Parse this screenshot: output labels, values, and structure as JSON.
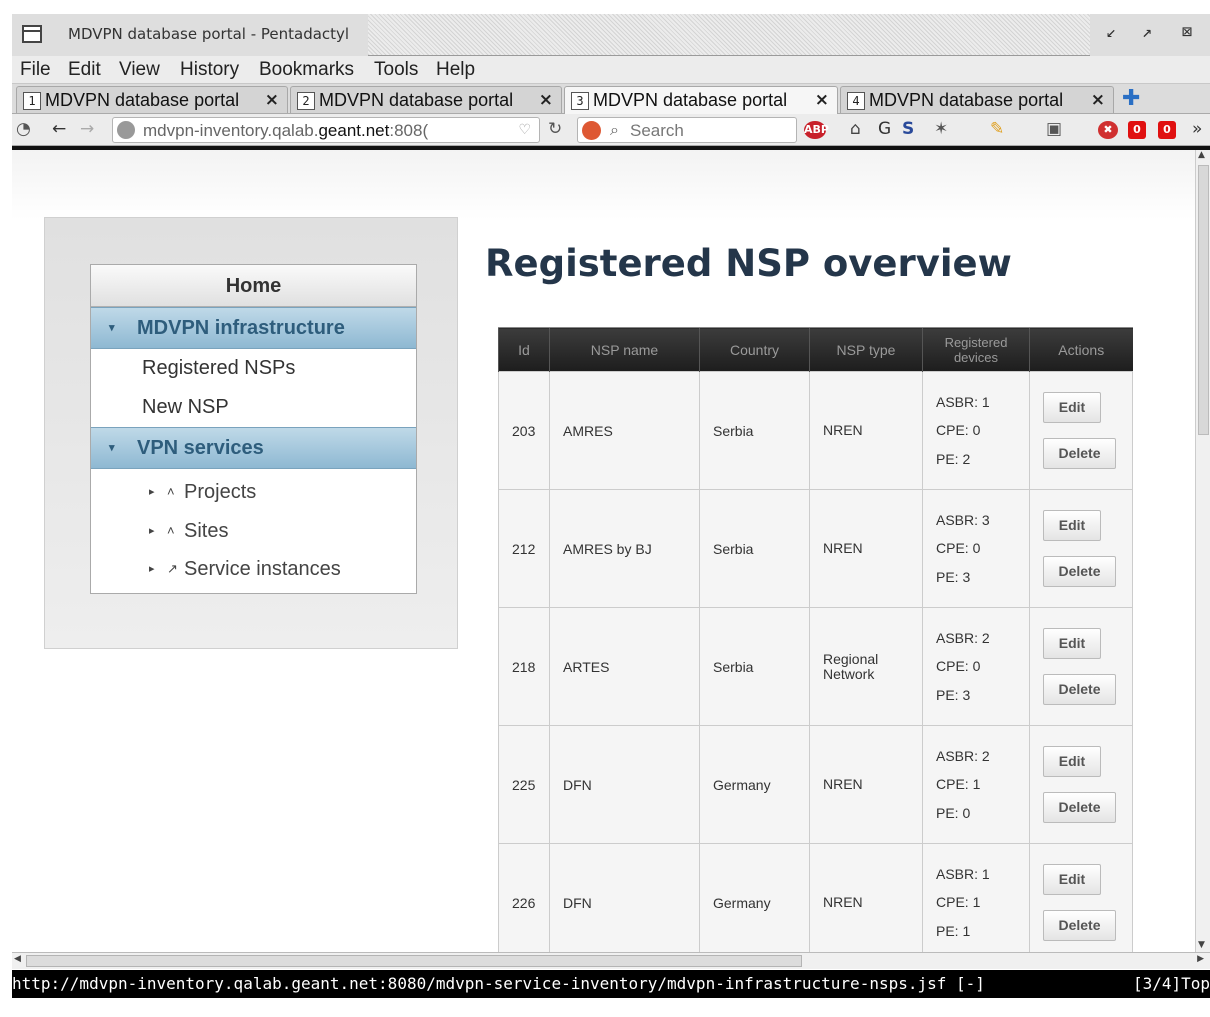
{
  "window": {
    "title": "MDVPN database portal - Pentadactyl"
  },
  "menubar": [
    "File",
    "Edit",
    "View",
    "History",
    "Bookmarks",
    "Tools",
    "Help"
  ],
  "tabs": [
    {
      "num": "1",
      "label": "MDVPN database portal"
    },
    {
      "num": "2",
      "label": "MDVPN database portal"
    },
    {
      "num": "3",
      "label": "MDVPN database portal"
    },
    {
      "num": "4",
      "label": "MDVPN database portal"
    }
  ],
  "navbar": {
    "url_prefix": "mdvpn-inventory.qalab.",
    "url_domain": "geant.net",
    "url_suffix": ":808(",
    "search_placeholder": "Search",
    "badge_counts": [
      "0",
      "0"
    ]
  },
  "sidebar": {
    "home": "Home",
    "section1": "MDVPN infrastructure",
    "section1_items": [
      "Registered NSPs",
      "New NSP"
    ],
    "section2": "VPN services",
    "section2_items": [
      "Projects",
      "Sites",
      "Service instances"
    ]
  },
  "page": {
    "title": "Registered NSP overview"
  },
  "table": {
    "headers": {
      "id": "Id",
      "name": "NSP name",
      "country": "Country",
      "type": "NSP type",
      "devices_l1": "Registered",
      "devices_l2": "devices",
      "actions": "Actions"
    },
    "edit_label": "Edit",
    "delete_label": "Delete",
    "rows": [
      {
        "id": "203",
        "name": "AMRES",
        "country": "Serbia",
        "type_l1": "NREN",
        "type_l2": "",
        "asbr": "ASBR: 1",
        "cpe": "CPE: 0",
        "pe": "PE: 2"
      },
      {
        "id": "212",
        "name": "AMRES by BJ",
        "country": "Serbia",
        "type_l1": "NREN",
        "type_l2": "",
        "asbr": "ASBR: 3",
        "cpe": "CPE: 0",
        "pe": "PE: 3"
      },
      {
        "id": "218",
        "name": "ARTES",
        "country": "Serbia",
        "type_l1": "Regional",
        "type_l2": "Network",
        "asbr": "ASBR: 2",
        "cpe": "CPE: 0",
        "pe": "PE: 3"
      },
      {
        "id": "225",
        "name": "DFN",
        "country": "Germany",
        "type_l1": "NREN",
        "type_l2": "",
        "asbr": "ASBR: 2",
        "cpe": "CPE: 1",
        "pe": "PE: 0"
      },
      {
        "id": "226",
        "name": "DFN",
        "country": "Germany",
        "type_l1": "NREN",
        "type_l2": "",
        "asbr": "ASBR: 1",
        "cpe": "CPE: 1",
        "pe": "PE: 1"
      }
    ]
  },
  "statusline": {
    "url": "http://mdvpn-inventory.qalab.geant.net:8080/mdvpn-service-inventory/mdvpn-infrastructure-nsps.jsf [-]",
    "position": "[3/4]Top"
  }
}
